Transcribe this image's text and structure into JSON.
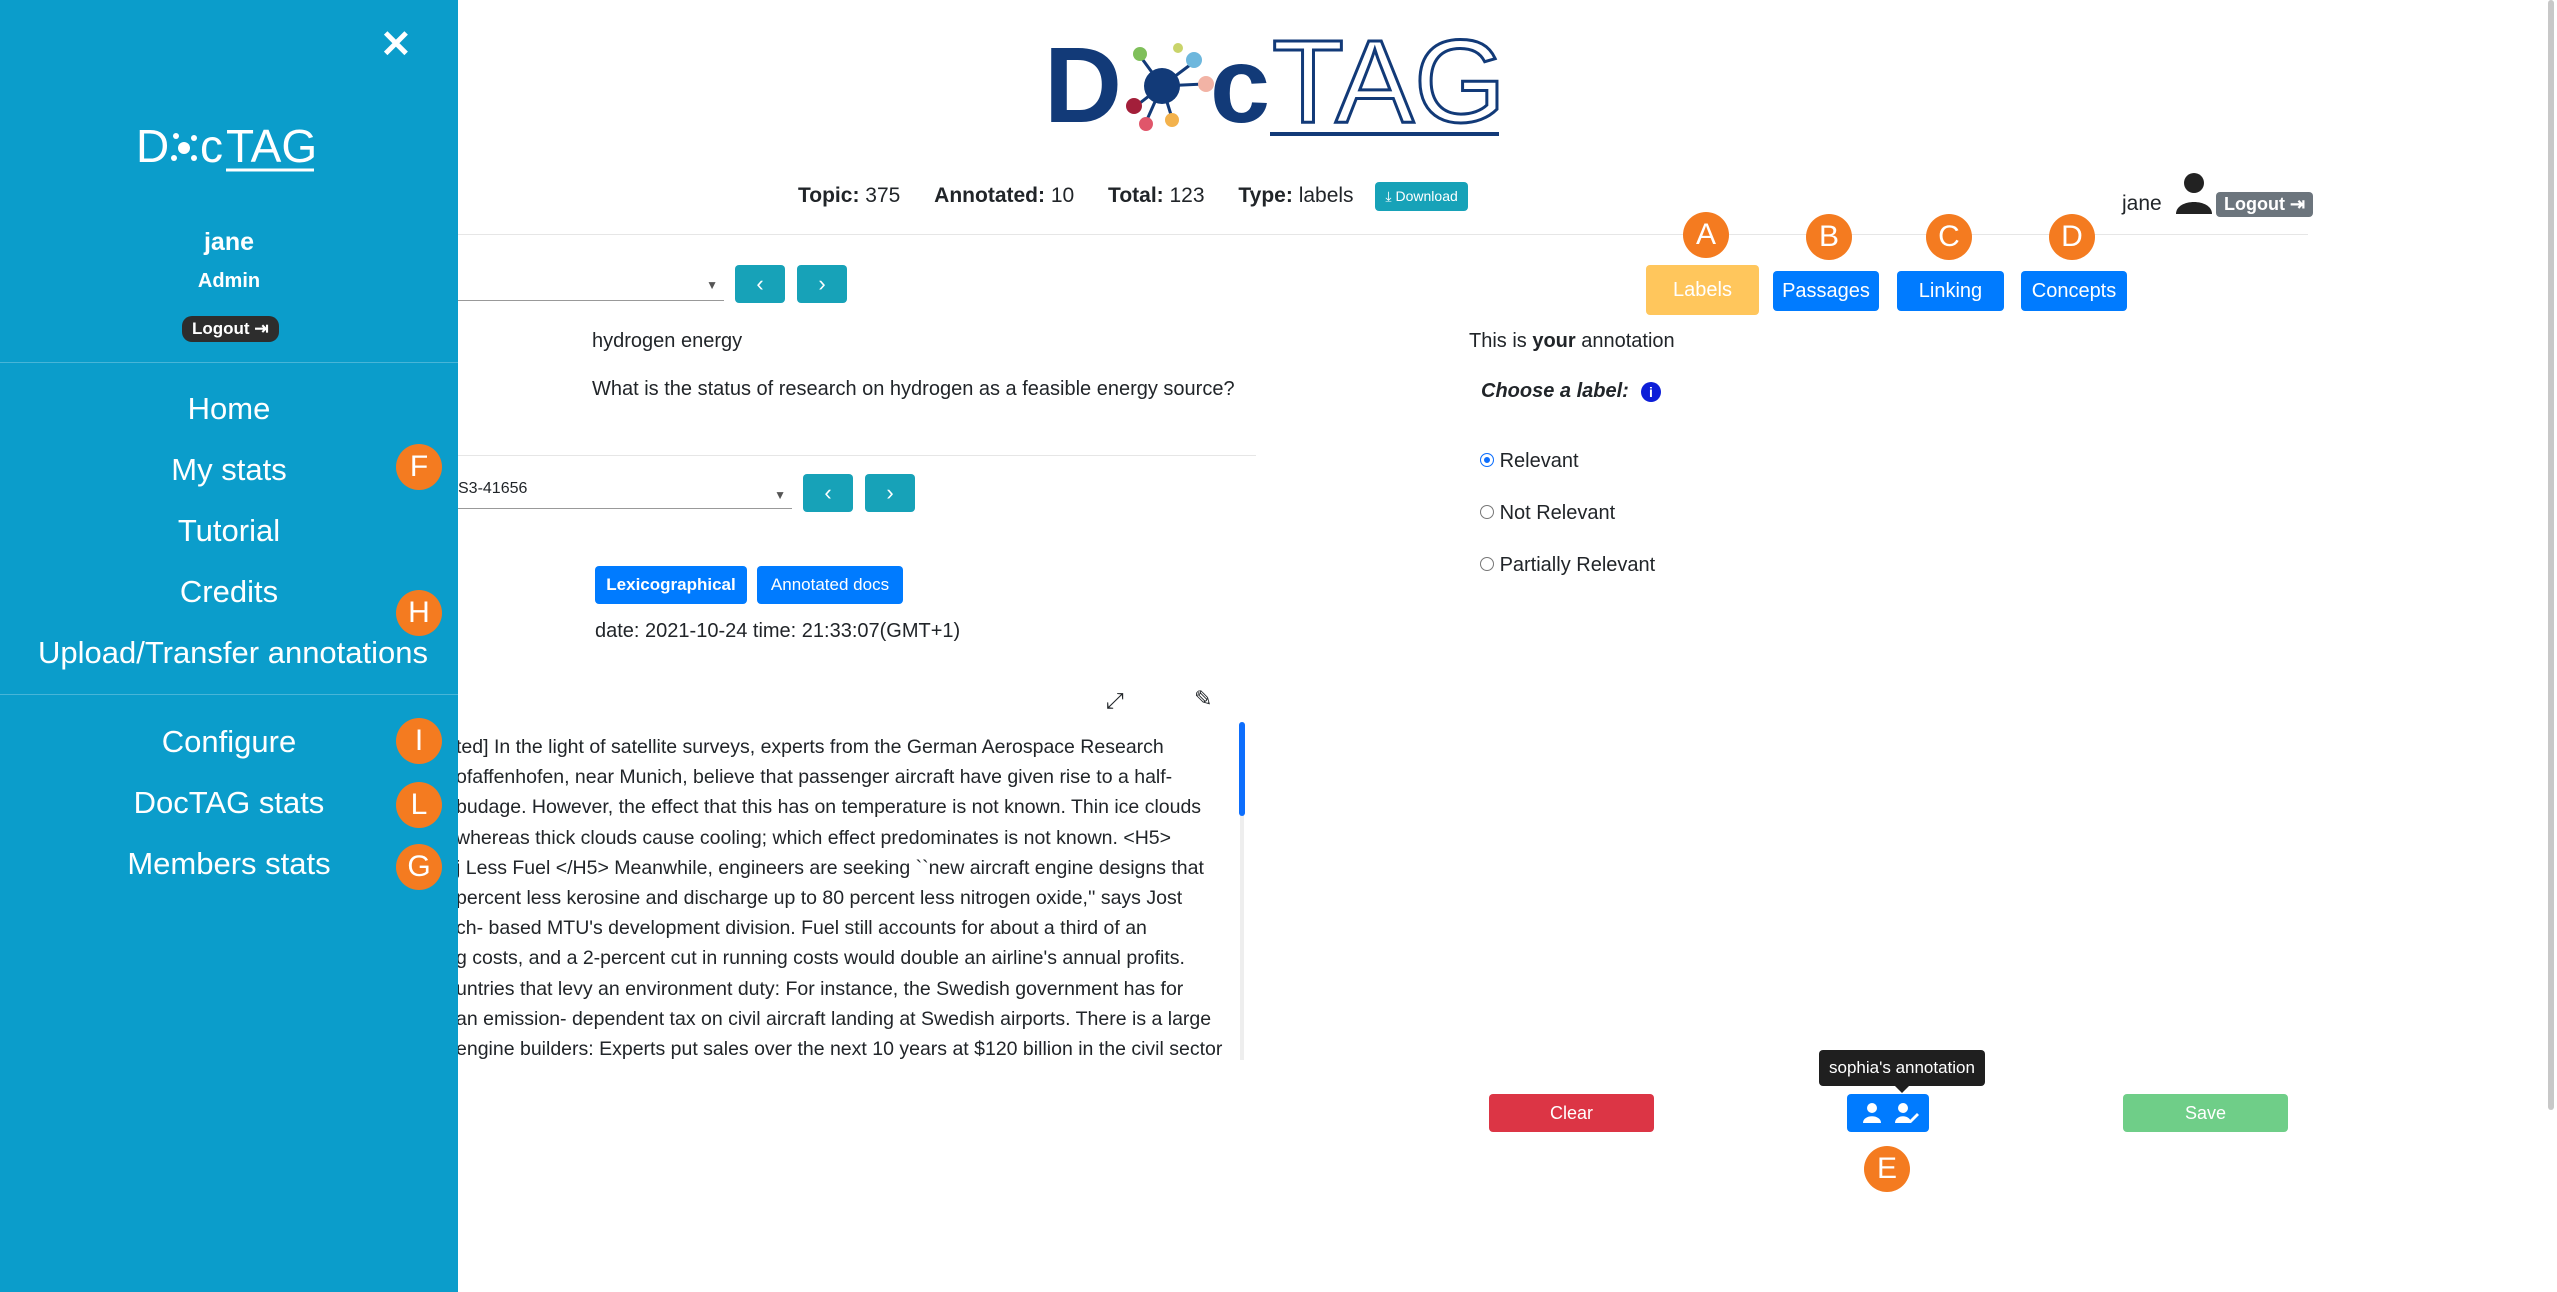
{
  "logo": {
    "text_left": "D",
    "text_mid": "c",
    "text_right": "TAG"
  },
  "stats": {
    "topic_label": "Topic:",
    "topic_value": "375",
    "annotated_label": "Annotated:",
    "annotated_value": "10",
    "total_label": "Total:",
    "total_value": "123",
    "type_label": "Type:",
    "type_value": "labels",
    "download_label": "Download"
  },
  "user_top": {
    "name": "jane",
    "logout_label": "Logout"
  },
  "topic": {
    "select_value": "",
    "title": "hydrogen energy",
    "description": "What is the status of research on hydrogen as a feasible energy source?"
  },
  "document": {
    "select_value": "S3-41656",
    "sort_active": "Lexicographical",
    "sort_other": "Annotated docs",
    "date_text": "date: 2021-10-24 time: 21:33:07(GMT+1)",
    "lines": [
      "ted] In the light of satellite surveys, experts from the German Aerospace Research",
      "ofaffenhofen, near Munich, believe that passenger aircraft have given rise to a half-",
      "budage. However, the effect that this has on temperature is not known. Thin ice clouds",
      "whereas thick clouds cause cooling; which effect predominates is not known. <H5>",
      "j Less Fuel </H5> Meanwhile, engineers are seeking ``new aircraft engine designs that",
      "percent less kerosine and discharge up to 80 percent less nitrogen oxide,'' says Jost",
      "ch- based MTU's development division. Fuel still accounts for about a third of an",
      "g costs, and a 2-percent cut in running costs would double an airline's annual profits.",
      "untries that levy an environment duty: For instance, the Swedish government has for",
      " an emission- dependent tax on civil aircraft landing at Swedish airports. There is a large",
      "engine builders: Experts put sales over the next 10 years at $120 billion in the civil sector"
    ]
  },
  "tabs": {
    "labels": "Labels",
    "passages": "Passages",
    "linking": "Linking",
    "concepts": "Concepts"
  },
  "markers": {
    "a": "A",
    "b": "B",
    "c": "C",
    "d": "D",
    "e": "E",
    "f": "F",
    "h": "H",
    "i": "I",
    "l": "L",
    "g": "G"
  },
  "annotation": {
    "intro_prefix": "This is ",
    "intro_bold": "your",
    "intro_suffix": " annotation",
    "choose_label": "Choose a label:",
    "options": [
      "Relevant",
      "Not Relevant",
      "Partially Relevant"
    ],
    "selected": "Relevant",
    "tooltip": "sophia's annotation",
    "clear_label": "Clear",
    "save_label": "Save"
  },
  "sidebar": {
    "close": "✕",
    "logo_left": "D",
    "logo_mid": "c",
    "logo_right": "TAG",
    "user_name": "jane",
    "user_role": "Admin",
    "logout_label": "Logout",
    "items": [
      "Home",
      "My stats",
      "Tutorial",
      "Credits",
      "Upload/Transfer annotations"
    ],
    "admin_items": [
      "Configure",
      "DocTAG stats",
      "Members stats"
    ]
  },
  "colors": {
    "sidebar": "#0b9dcb",
    "primary": "#007bff",
    "teal": "#17a2b8",
    "orange": "#f47b20",
    "labels_active": "#ffc65c",
    "clear": "#dc3545",
    "save": "#6fce88"
  }
}
